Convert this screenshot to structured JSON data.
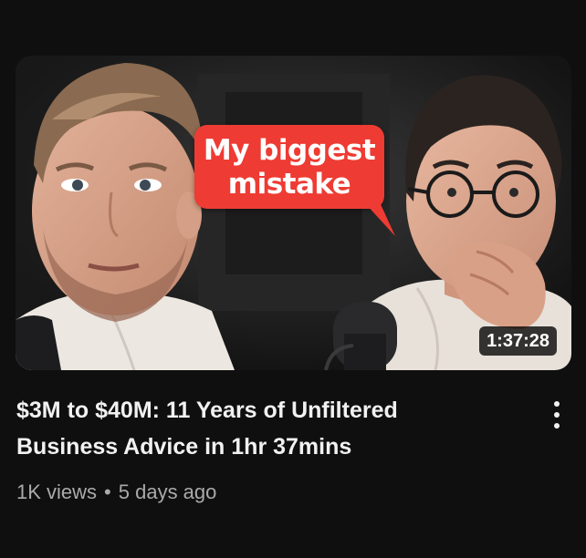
{
  "video": {
    "thumbnail_caption_line1": "My biggest",
    "thumbnail_caption_line2": "mistake",
    "duration": "1:37:28",
    "title": "$3M to $40M: 11 Years of Unfiltered Business Advice in 1hr 37mins",
    "views": "1K views",
    "separator": "•",
    "age": "5 days ago",
    "menu_icon": "more-vertical-icon"
  },
  "colors": {
    "background": "#0f0f0f",
    "bubble": "#ee3b33",
    "title_text": "#f1f1f1",
    "meta_text": "#aaaaaa"
  }
}
